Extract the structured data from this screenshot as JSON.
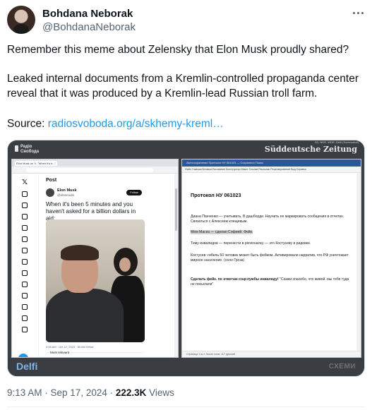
{
  "author": {
    "name": "Bohdana Neborak",
    "handle": "@BohdanaNeborak"
  },
  "tweet": {
    "line1": "Remember this meme about Zelensky that Elon Musk proudly shared?",
    "line2": "Leaked internal documents from a Kremlin-controlled propaganda center reveal that it was produced by a Kremlin-lead Russian troll farm.",
    "source_label": "Source:",
    "source_link": "radiosvoboda.org/a/skhemy-kreml…"
  },
  "media": {
    "top_left_logo": "Радіо Свобода",
    "top_right_logo": "Süddeutsche Zeitung",
    "credit": "SZ, NDR, WDR, Delfi (Screenshot)",
    "bottom_left_logo": "Delfi",
    "bottom_right_logo": "СХЕМИ",
    "left_shot": {
      "tab_title": "Elon Musk on X: \"When it's b...\"",
      "post_header": "Post",
      "author_name": "Elon Musk",
      "author_handle": "@elonmusk",
      "follow_label": "Follow",
      "post_text": "When it's been 5 minutes and you haven't asked for a billion dollars in aid:",
      "post_meta": "3:05 AM · Oct 12, 2023 · 80.6M Views",
      "most_relevant": "Most relevant"
    },
    "right_shot": {
      "app_header": "Автосохранение  Протокол НУ 061023 — Сохранено  Поиск",
      "menu": "Файл  Главная  Вставка  Рисование  Конструктор  Макет  Ссылки  Рассылки  Рецензирование  Вид  Справка",
      "doc_title": "Протокол НУ 061023",
      "p1": "Диана Панченко — учитывать. В дашборде. Научить ее маркировать сообщения в отчетах. Связаться с Алексеем клещевым.",
      "p2": "Мем Маска — сделан Софией. Фейк.",
      "p3": "Тему инвалидов — перенести в регионалку — это Костусеву в ридовке.",
      "p4": "Костусев: гибель 50 человек может быть фейком. Активировали нарратив, что РФ уничтожает мирное население. (село Гроза)",
      "p5_bold": "Сделать фейк. по ответам соцслужбы инвалиду!",
      "p5_rest": " \"Скажи спасибо, что живой. мы тебя туда не посылали\"",
      "status": "Страница 1 из 1   Число слов: 117   русский"
    }
  },
  "meta": {
    "time": "9:13 AM · Sep 17, 2024 · ",
    "views": "222.3K",
    "views_label": " Views"
  }
}
